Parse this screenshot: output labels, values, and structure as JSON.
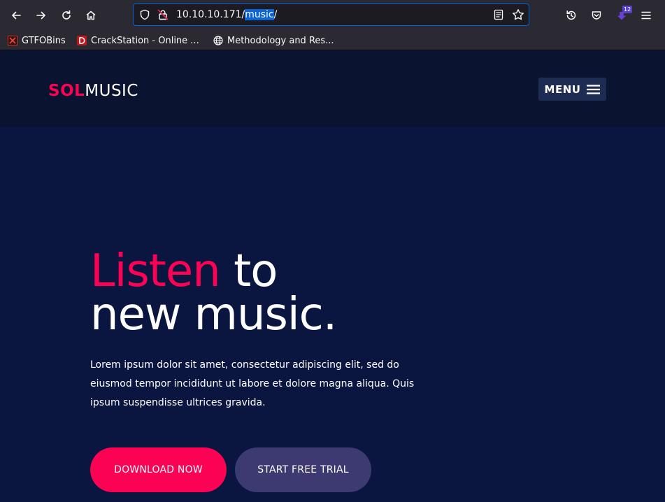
{
  "browser": {
    "url_prefix": "10.10.10.171/",
    "url_selected": "music",
    "url_suffix": "/",
    "extension_badge": "12",
    "bookmarks": [
      {
        "label": "GTFOBins",
        "icon": "gtfobins-favicon"
      },
      {
        "label": "CrackStation - Online ...",
        "icon": "crackstation-favicon"
      },
      {
        "label": "Methodology and Res...",
        "icon": "globe-icon"
      }
    ],
    "colors": {
      "chrome": "#2b2a33",
      "urlbar": "#1c1b22",
      "focus": "#0061e0"
    }
  },
  "site": {
    "logo_accent": "SOL",
    "logo_rest": "MUSIC",
    "menu_label": "MENU",
    "hero": {
      "title_accent": "Listen",
      "title_rest_1": " to",
      "title_line_2": "new music.",
      "text": "Lorem ipsum dolor sit amet, consectetur adipiscing elit, sed do eiusmod tempor incididunt ut labore et dolore magna aliqua. Quis ipsum suspendisse ultrices gravida."
    },
    "buttons": {
      "download": "DOWNLOAD NOW",
      "trial": "START FREE TRIAL"
    },
    "colors": {
      "accent": "#fc0254",
      "background": "#0b1640",
      "secondary_button": "#3c3a70"
    }
  }
}
